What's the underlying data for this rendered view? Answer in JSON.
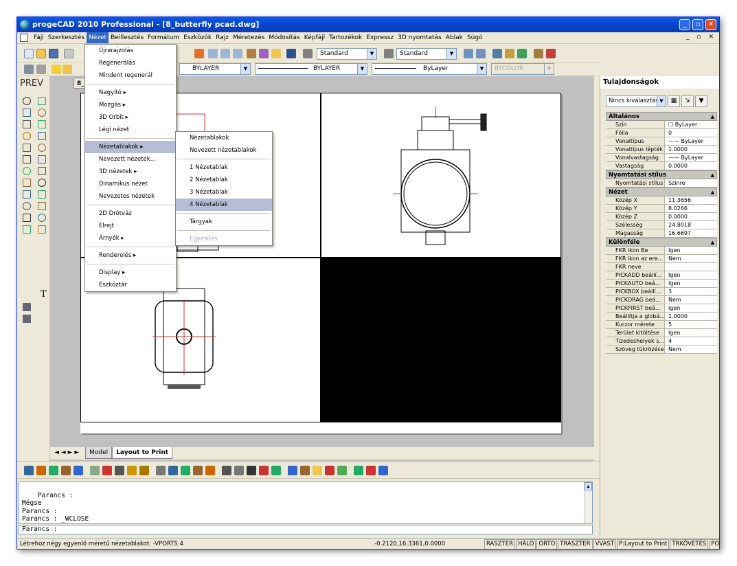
{
  "window": {
    "title": "progeCAD 2010 Professional - [8_butterfly pcad.dwg]",
    "min": "_",
    "max": "▫",
    "close": "✕"
  },
  "menubar": [
    "Fájl",
    "Szerkesztés",
    "Nézet",
    "Beillesztés",
    "Formátum",
    "Eszközök",
    "Rajz",
    "Méretezés",
    "Módosítás",
    "Képfájl",
    "Tartozékok",
    "Expressz",
    "3D nyomtatás",
    "Ablak",
    "Súgó"
  ],
  "mdi_buttons": "_ ▫ ✕",
  "toolbar": {
    "text_style": "Standard",
    "dim_style": "Standard",
    "layer": "BYLAYER",
    "linetype": "BYLAYER",
    "lineweight": "ByLayer",
    "color": "BYCOLOR"
  },
  "left_toolbar": {
    "prev_label": "PREV",
    "text_tool": "T"
  },
  "doc_tab": "8_bu",
  "layout_tabs": {
    "nav": "◄ ◄ ► ►",
    "model": "Model",
    "layout": "Layout to Print"
  },
  "command_history": "Parancs :\nMégse\nParancs :\nParancs : _WCLOSE",
  "command_prompt": "Parancs :",
  "status": {
    "message": "Létrehoz négy egyenlő méretű nézetablakot: -VPORTS 4",
    "coords": "-0.2120,16.3361,0.0000",
    "toggles": [
      "RASZTER",
      "HÁLÓ",
      "ORTO",
      "TRASZTER",
      "VVAST",
      "P:Layout to Print",
      "TRKÖVETÉS",
      "POLÁRIS"
    ]
  },
  "properties": {
    "title": "Tulajdonságok",
    "selection": "Nincs kiválasztás",
    "sections": [
      {
        "name": "Általános",
        "rows": [
          [
            "Szín",
            "☐ ByLayer"
          ],
          [
            "Fólia",
            "0"
          ],
          [
            "Vonaltípus",
            "—— ByLayer"
          ],
          [
            "Vonaltípus lépték",
            "1.0000"
          ],
          [
            "Vonalvastagság",
            "—— ByLayer"
          ],
          [
            "Vastagság",
            "0.0000"
          ]
        ]
      },
      {
        "name": "Nyomtatási stílus",
        "rows": [
          [
            "Nyomtatási stílus",
            "Színre"
          ]
        ]
      },
      {
        "name": "Nézet",
        "rows": [
          [
            "Közép X",
            "11.3656"
          ],
          [
            "Közép Y",
            "8.0266"
          ],
          [
            "Közép Z",
            "0.0000"
          ],
          [
            "Szélesség",
            "24.8018"
          ],
          [
            "Magasság",
            "16.6697"
          ]
        ]
      },
      {
        "name": "Különféle",
        "rows": [
          [
            "FKR ikon Be",
            "Igen"
          ],
          [
            "FKR ikon az ere...",
            "Nem"
          ],
          [
            "FKR neve",
            ""
          ],
          [
            "PICKADD beállí...",
            "Igen"
          ],
          [
            "PICKAUTO beá...",
            "Igen"
          ],
          [
            "PICKBOX beállí...",
            "3"
          ],
          [
            "PICKDRAG beá...",
            "Nem"
          ],
          [
            "PICKFIRST beá...",
            "Igen"
          ],
          [
            "Beállítja a globá...",
            "1.0000"
          ],
          [
            "Kurzor mérete",
            "5"
          ],
          [
            "Terület kitöltése",
            "Igen"
          ],
          [
            "Tizedeshelyek s...",
            "4"
          ],
          [
            "Szöveg tükrözése",
            "Nem"
          ]
        ]
      }
    ]
  },
  "nezet_menu": [
    "Újrarajzolás",
    "Regenerálás",
    "Mindent regenerál",
    "---",
    "Nagyító ▸",
    "Mozgás ▸",
    "3D Orbit ▸",
    "Légi nézet",
    "---",
    "Nézetablakok ▸",
    "Nevezett nézetek...",
    "3D nézetek ▸",
    "Dinamikus nézet",
    "Nevezetes nézetek",
    "---",
    "2D Drótváz",
    "Elrejt",
    "Árnyék ▸",
    "---",
    "Renderelés ▸",
    "---",
    "Display ▸",
    "Eszköztár"
  ],
  "nezet_menu_highlight": "Nézetablakok ▸",
  "viewport_submenu": [
    "Nézetablakok",
    "Nevezett nézetablakok",
    "---",
    "1 Nézetablak",
    "2 Nézetablak",
    "3 Nézetablak",
    "4 Nézetablak",
    "---",
    "Tárgyak",
    "---",
    "Egyesítés"
  ],
  "viewport_submenu_highlight": "4 Nézetablak",
  "viewport_submenu_disabled": "Egyesítés"
}
